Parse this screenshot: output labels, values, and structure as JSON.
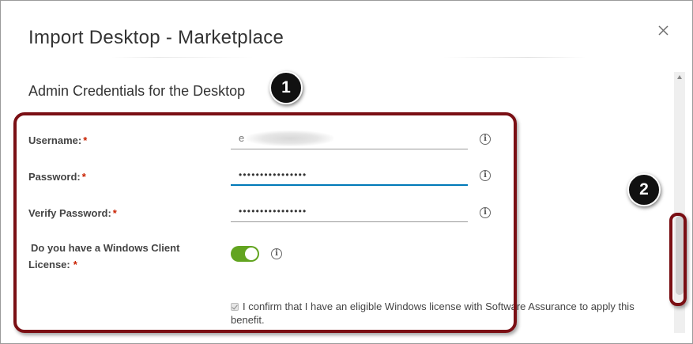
{
  "dialog": {
    "title": "Import Desktop - Marketplace",
    "close_icon": "close-icon",
    "section_title": "Admin Credentials for the Desktop"
  },
  "callouts": {
    "one": "1",
    "two": "2"
  },
  "form": {
    "username": {
      "label": "Username:",
      "required": "*",
      "value": "e"
    },
    "password": {
      "label": "Password:",
      "required": "*",
      "value": "••••••••••••••••"
    },
    "verify_password": {
      "label": "Verify Password:",
      "required": "*",
      "value": "••••••••••••••••"
    },
    "windows_license": {
      "label_line1": "Do you have a Windows Client",
      "label_line2": "License:",
      "required": "*",
      "toggle_on": true
    },
    "confirm_text": "I confirm that I have an eligible Windows license with Software Assurance to apply this benefit."
  },
  "icons": {
    "info": "info-icon",
    "info_glyph": "i"
  },
  "colors": {
    "required": "#c92100",
    "focus": "#0079b8",
    "toggle_on": "#62a420",
    "highlight": "#7a0f14"
  }
}
